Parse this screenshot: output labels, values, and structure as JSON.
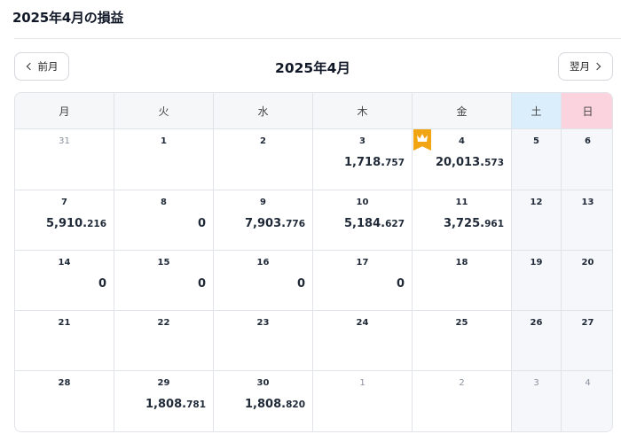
{
  "page": {
    "title": "2025年4月の損益"
  },
  "nav": {
    "prev_label": "前月",
    "next_label": "翌月",
    "month_title": "2025年4月"
  },
  "colors": {
    "saturday_header": "#dbeefc",
    "sunday_header": "#fbd3df",
    "best_day_badge": "#f1a512",
    "weekend_cell": "#f6f7fb"
  },
  "calendar": {
    "weekdays": [
      "月",
      "火",
      "水",
      "木",
      "金",
      "土",
      "日"
    ],
    "weeks": [
      [
        {
          "day": "31",
          "other": true,
          "int": "",
          "dec": ""
        },
        {
          "day": "1",
          "int": "",
          "dec": ""
        },
        {
          "day": "2",
          "int": "",
          "dec": ""
        },
        {
          "day": "3",
          "int": "1,718.",
          "dec": "757"
        },
        {
          "day": "4",
          "int": "20,013.",
          "dec": "573",
          "badge": "crown-icon"
        },
        {
          "day": "5",
          "int": "",
          "dec": ""
        },
        {
          "day": "6",
          "int": "",
          "dec": ""
        }
      ],
      [
        {
          "day": "7",
          "int": "5,910.",
          "dec": "216"
        },
        {
          "day": "8",
          "int": "0",
          "dec": ""
        },
        {
          "day": "9",
          "int": "7,903.",
          "dec": "776"
        },
        {
          "day": "10",
          "int": "5,184.",
          "dec": "627"
        },
        {
          "day": "11",
          "int": "3,725.",
          "dec": "961"
        },
        {
          "day": "12",
          "int": "",
          "dec": ""
        },
        {
          "day": "13",
          "int": "",
          "dec": ""
        }
      ],
      [
        {
          "day": "14",
          "int": "0",
          "dec": ""
        },
        {
          "day": "15",
          "int": "0",
          "dec": ""
        },
        {
          "day": "16",
          "int": "0",
          "dec": ""
        },
        {
          "day": "17",
          "int": "0",
          "dec": ""
        },
        {
          "day": "18",
          "int": "",
          "dec": ""
        },
        {
          "day": "19",
          "int": "",
          "dec": ""
        },
        {
          "day": "20",
          "int": "",
          "dec": ""
        }
      ],
      [
        {
          "day": "21",
          "int": "",
          "dec": ""
        },
        {
          "day": "22",
          "int": "",
          "dec": ""
        },
        {
          "day": "23",
          "int": "",
          "dec": ""
        },
        {
          "day": "24",
          "int": "",
          "dec": ""
        },
        {
          "day": "25",
          "int": "",
          "dec": ""
        },
        {
          "day": "26",
          "int": "",
          "dec": ""
        },
        {
          "day": "27",
          "int": "",
          "dec": ""
        }
      ],
      [
        {
          "day": "28",
          "int": "",
          "dec": ""
        },
        {
          "day": "29",
          "int": "1,808.",
          "dec": "781"
        },
        {
          "day": "30",
          "int": "1,808.",
          "dec": "820"
        },
        {
          "day": "1",
          "other": true,
          "int": "",
          "dec": ""
        },
        {
          "day": "2",
          "other": true,
          "int": "",
          "dec": ""
        },
        {
          "day": "3",
          "other": true,
          "int": "",
          "dec": ""
        },
        {
          "day": "4",
          "other": true,
          "int": "",
          "dec": ""
        }
      ]
    ]
  }
}
